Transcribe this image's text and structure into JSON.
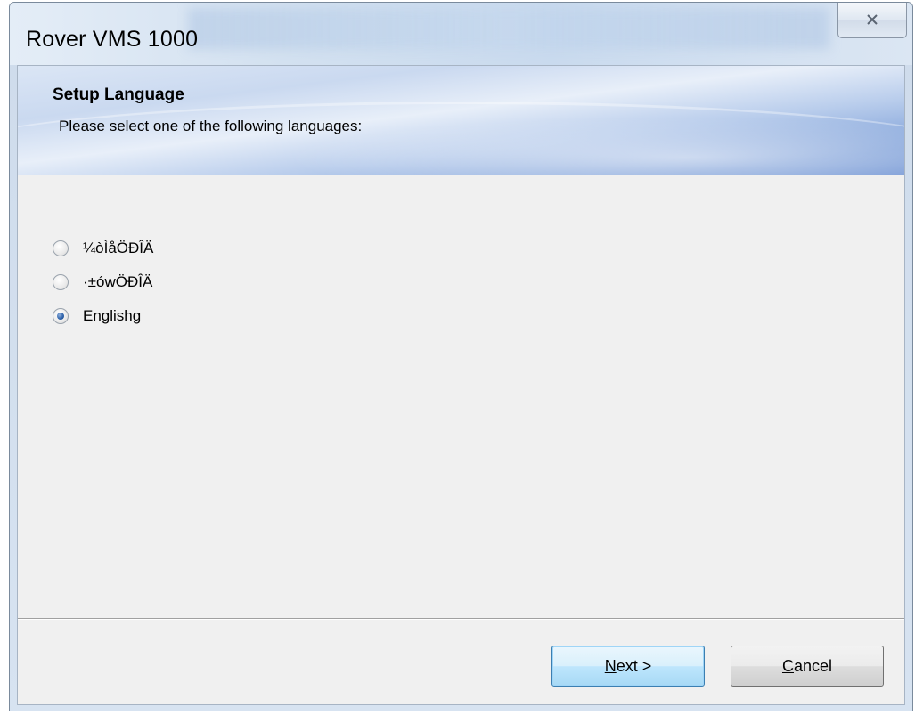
{
  "window": {
    "title": "Rover VMS 1000",
    "close_glyph": "☒"
  },
  "banner": {
    "title": "Setup Language",
    "subtitle": "Please select one of the following languages:"
  },
  "languages": [
    {
      "label": "¼òÌåÖÐÎÄ",
      "selected": false
    },
    {
      "label": "·±ówÖÐÎÄ",
      "selected": false
    },
    {
      "label": "Englishg",
      "selected": true
    }
  ],
  "buttons": {
    "next": {
      "mnemonic": "N",
      "rest": "ext >"
    },
    "cancel": {
      "mnemonic": "C",
      "rest": "ancel"
    }
  }
}
